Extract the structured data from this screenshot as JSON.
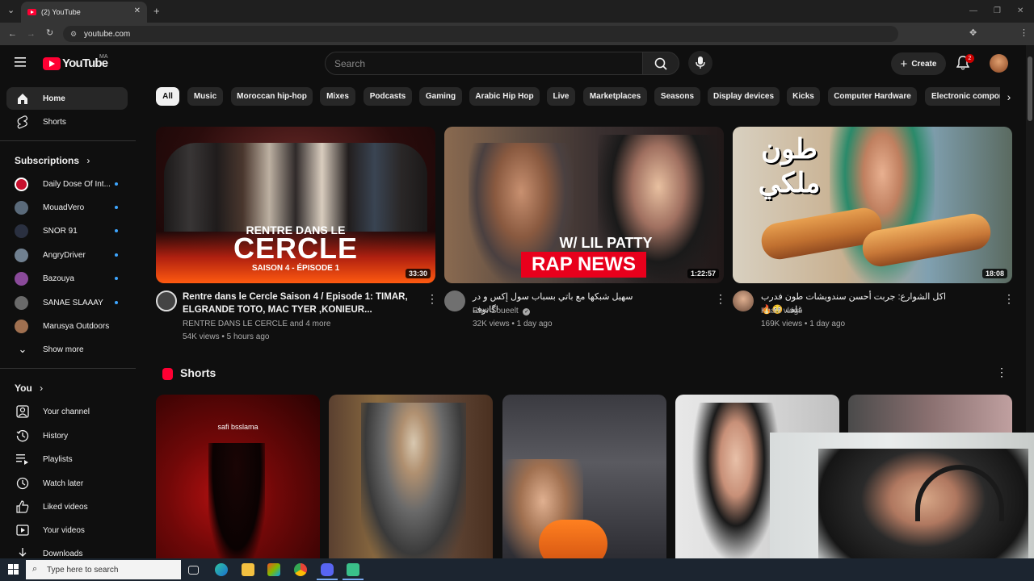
{
  "browser": {
    "tab_title": "(2) YouTube",
    "url": "youtube.com"
  },
  "header": {
    "logo_text": "YouTube",
    "country_code": "MA",
    "search_placeholder": "Search",
    "create_label": "Create",
    "notification_count": "2"
  },
  "sidebar": {
    "main": [
      {
        "label": "Home",
        "icon": "home-icon",
        "active": true
      },
      {
        "label": "Shorts",
        "icon": "shorts-icon"
      }
    ],
    "subscriptions_heading": "Subscriptions",
    "subscriptions": [
      {
        "label": "Daily Dose Of Int...",
        "color": "#c8102e",
        "new": true
      },
      {
        "label": "MouadVero",
        "color": "#5a6a7a",
        "new": true
      },
      {
        "label": "SNOR 91",
        "color": "#2a3040",
        "new": true
      },
      {
        "label": "AngryDriver",
        "color": "#708090",
        "new": true
      },
      {
        "label": "Bazouya",
        "color": "#8a4a9a",
        "new": true
      },
      {
        "label": "SANAE SLAAAY",
        "color": "#6a6a6a",
        "new": true
      },
      {
        "label": "Marusya Outdoors",
        "color": "#a07050",
        "new": false
      }
    ],
    "show_more": "Show more",
    "you_heading": "You",
    "you_items": [
      {
        "label": "Your channel",
        "icon": "account-box-icon"
      },
      {
        "label": "History",
        "icon": "history-icon"
      },
      {
        "label": "Playlists",
        "icon": "playlists-icon"
      },
      {
        "label": "Watch later",
        "icon": "clock-icon"
      },
      {
        "label": "Liked videos",
        "icon": "thumbs-up-icon"
      },
      {
        "label": "Your videos",
        "icon": "play-box-icon"
      },
      {
        "label": "Downloads",
        "icon": "download-icon"
      }
    ]
  },
  "chips": [
    "All",
    "Music",
    "Moroccan hip-hop",
    "Mixes",
    "Podcasts",
    "Gaming",
    "Arabic Hip Hop",
    "Live",
    "Marketplaces",
    "Seasons",
    "Display devices",
    "Kicks",
    "Computer Hardware",
    "Electronic compon"
  ],
  "videos": [
    {
      "title": "Rentre dans le Cercle Saison 4 / Episode 1: TIMAR, ELGRANDE TOTO, MAC TYER ,KONIEUR...",
      "channel": "RENTRE DANS LE CERCLE and 4 more",
      "meta": "54K views • 5 hours ago",
      "duration": "33:30",
      "thumb_line1": "RENTRE DANS LE",
      "thumb_line2": "CERCLE",
      "thumb_line3": "SAISON 4 - ÉPISODE 1"
    },
    {
      "title": "سهيل شبكها مع باتي بسباب سول إكس و در اگانوف",
      "channel": "Raw Soueelt",
      "meta": "32K views • 1 day ago",
      "duration": "1:22:57",
      "thumb_line1": "W/ LIL PATTY",
      "thumb_line2": "RAP NEWS"
    },
    {
      "title": "اكل الشوارع: جربت أحسن سندويشات طون فدرب غلف 😳🔥",
      "channel": "Khalfi vlogs",
      "meta": "169K views • 1 day ago",
      "duration": "18:08",
      "thumb_line1": "طون",
      "thumb_line2": "ملكي"
    }
  ],
  "shorts": {
    "heading": "Shorts",
    "items": [
      {
        "overlay": "safi bsslama"
      },
      {
        "overlay": ""
      },
      {
        "overlay": ""
      },
      {
        "overlay": ""
      },
      {
        "overlay": ""
      }
    ]
  },
  "taskbar": {
    "search_placeholder": "Type here to search"
  },
  "colors": {
    "background": "#0f0f0f",
    "brand_red": "#ff0033",
    "accent_blue": "#3ea6ff"
  }
}
